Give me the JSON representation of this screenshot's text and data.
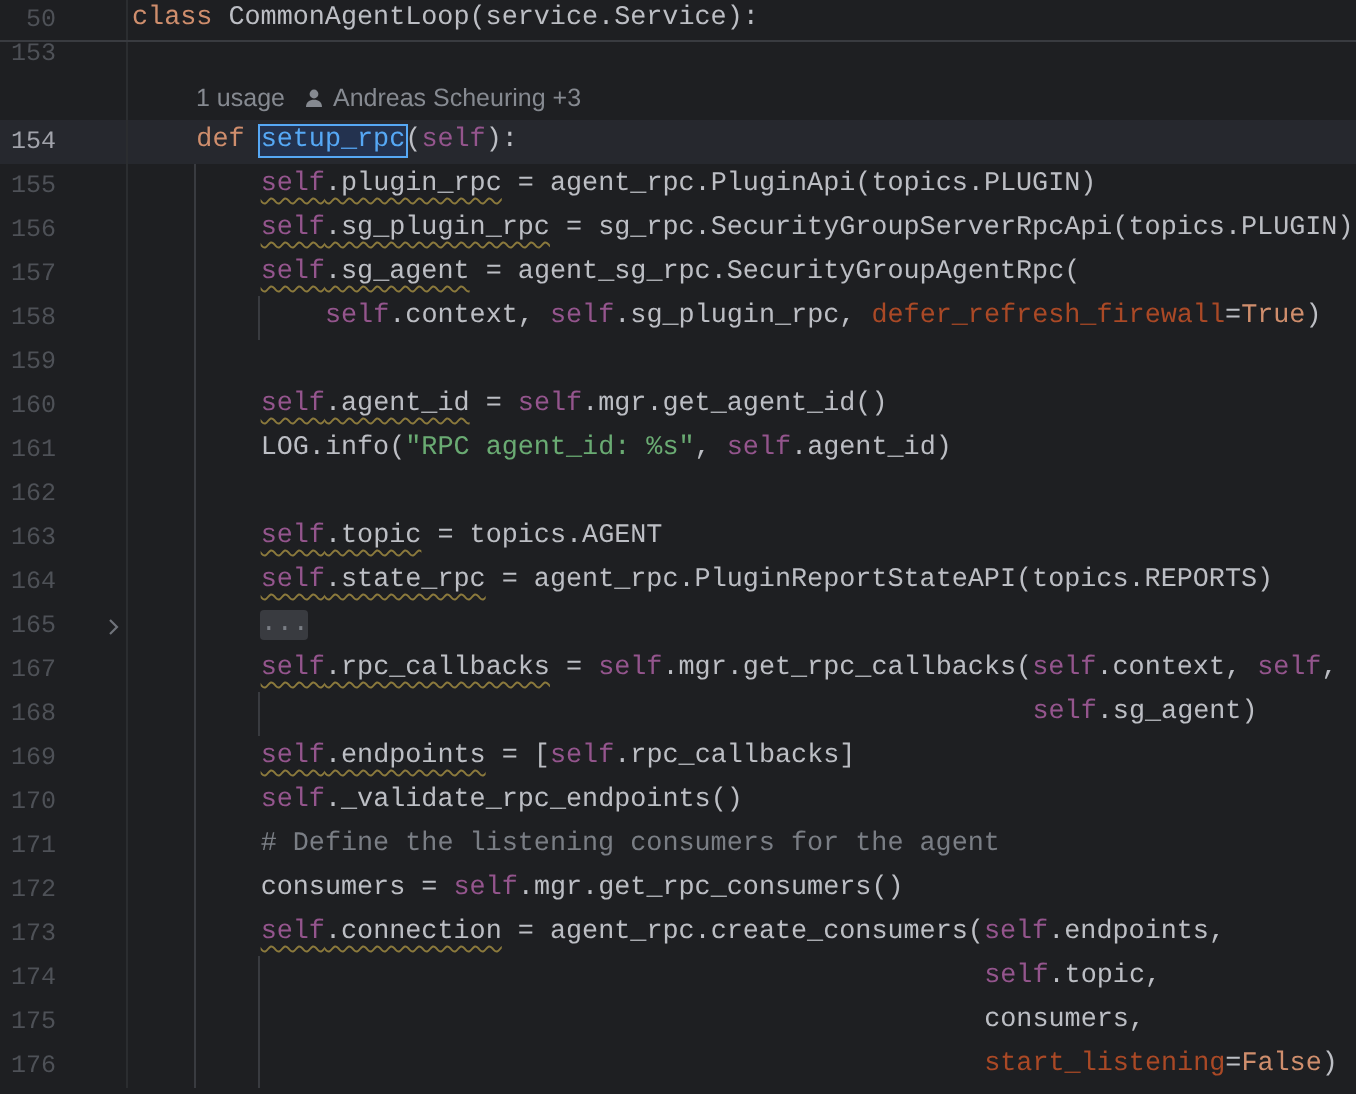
{
  "sticky_header": {
    "number": "50",
    "tokens": [
      {
        "kind": "keyword",
        "text": "class"
      },
      {
        "kind": "plain",
        "text": " CommonAgentLoop(service.Service):"
      }
    ]
  },
  "lines": [
    {
      "kind": "blank",
      "number": "153",
      "current": false,
      "foldable": false
    },
    {
      "kind": "inlay",
      "usage": "1 usage",
      "author": "Andreas Scheuring +3"
    },
    {
      "kind": "def",
      "number": "154",
      "current": true,
      "foldable": false,
      "tokens": [
        {
          "kind": "keyword",
          "text": "def "
        },
        {
          "kind": "function_selected",
          "text": "setup_rpc"
        },
        {
          "kind": "plain",
          "text": "("
        },
        {
          "kind": "self",
          "text": "self"
        },
        {
          "kind": "plain",
          "text": "):"
        }
      ]
    },
    {
      "kind": "body",
      "number": "155",
      "current": false,
      "foldable": false,
      "tokens": [
        {
          "kind": "self_warn",
          "text": "self"
        },
        {
          "kind": "plain_warn",
          "text": ".plugin_rpc"
        },
        {
          "kind": "plain",
          "text": " = agent_rpc.PluginApi(topics.PLUGIN)"
        }
      ]
    },
    {
      "kind": "body",
      "number": "156",
      "current": false,
      "foldable": false,
      "tokens": [
        {
          "kind": "self_warn",
          "text": "self"
        },
        {
          "kind": "plain_warn",
          "text": ".sg_plugin_rpc"
        },
        {
          "kind": "plain",
          "text": " = sg_rpc.SecurityGroupServerRpcApi(topics.PLUGIN)"
        }
      ]
    },
    {
      "kind": "body",
      "number": "157",
      "current": false,
      "foldable": false,
      "tokens": [
        {
          "kind": "self_warn",
          "text": "self"
        },
        {
          "kind": "plain_warn",
          "text": ".sg_agent"
        },
        {
          "kind": "plain",
          "text": " = agent_sg_rpc.SecurityGroupAgentRpc("
        }
      ]
    },
    {
      "kind": "hanging",
      "number": "158",
      "current": false,
      "foldable": false,
      "tokens": [
        {
          "kind": "self",
          "text": "self"
        },
        {
          "kind": "plain",
          "text": ".context, "
        },
        {
          "kind": "self",
          "text": "self"
        },
        {
          "kind": "plain",
          "text": ".sg_plugin_rpc, "
        },
        {
          "kind": "param",
          "text": "defer_refresh_firewall"
        },
        {
          "kind": "plain",
          "text": "="
        },
        {
          "kind": "keyword",
          "text": "True"
        },
        {
          "kind": "plain",
          "text": ")"
        }
      ]
    },
    {
      "kind": "blank",
      "number": "159",
      "current": false,
      "foldable": false
    },
    {
      "kind": "body",
      "number": "160",
      "current": false,
      "foldable": false,
      "tokens": [
        {
          "kind": "self_warn",
          "text": "self"
        },
        {
          "kind": "plain_warn",
          "text": ".agent_id"
        },
        {
          "kind": "plain",
          "text": " = "
        },
        {
          "kind": "self",
          "text": "self"
        },
        {
          "kind": "plain",
          "text": ".mgr.get_agent_id()"
        }
      ]
    },
    {
      "kind": "body",
      "number": "161",
      "current": false,
      "foldable": false,
      "tokens": [
        {
          "kind": "plain",
          "text": "LOG.info("
        },
        {
          "kind": "string",
          "text": "\"RPC agent_id: %s\""
        },
        {
          "kind": "plain",
          "text": ", "
        },
        {
          "kind": "self",
          "text": "self"
        },
        {
          "kind": "plain",
          "text": ".agent_id)"
        }
      ]
    },
    {
      "kind": "blank",
      "number": "162",
      "current": false,
      "foldable": false
    },
    {
      "kind": "body",
      "number": "163",
      "current": false,
      "foldable": false,
      "tokens": [
        {
          "kind": "self_warn",
          "text": "self"
        },
        {
          "kind": "plain_warn",
          "text": ".topic"
        },
        {
          "kind": "plain",
          "text": " = topics.AGENT"
        }
      ]
    },
    {
      "kind": "body",
      "number": "164",
      "current": false,
      "foldable": false,
      "tokens": [
        {
          "kind": "self_warn",
          "text": "self"
        },
        {
          "kind": "plain_warn",
          "text": ".state_rpc"
        },
        {
          "kind": "plain",
          "text": " = agent_rpc.PluginReportStateAPI(topics.REPORTS)"
        }
      ]
    },
    {
      "kind": "body",
      "number": "165",
      "current": false,
      "foldable": true,
      "tokens": [
        {
          "kind": "folded",
          "text": "..."
        }
      ]
    },
    {
      "kind": "body",
      "number": "167",
      "current": false,
      "foldable": false,
      "tokens": [
        {
          "kind": "self_warn",
          "text": "self"
        },
        {
          "kind": "plain_warn",
          "text": ".rpc_callbacks"
        },
        {
          "kind": "plain",
          "text": " = "
        },
        {
          "kind": "self",
          "text": "self"
        },
        {
          "kind": "plain",
          "text": ".mgr.get_rpc_callbacks("
        },
        {
          "kind": "self",
          "text": "self"
        },
        {
          "kind": "plain",
          "text": ".context, "
        },
        {
          "kind": "self",
          "text": "self"
        },
        {
          "kind": "plain",
          "text": ","
        }
      ]
    },
    {
      "kind": "aligned",
      "number": "168",
      "current": false,
      "foldable": false,
      "tokens": [
        {
          "kind": "self",
          "text": "self"
        },
        {
          "kind": "plain",
          "text": ".sg_agent)"
        }
      ]
    },
    {
      "kind": "body",
      "number": "169",
      "current": false,
      "foldable": false,
      "tokens": [
        {
          "kind": "self_warn",
          "text": "self"
        },
        {
          "kind": "plain_warn",
          "text": ".endpoints"
        },
        {
          "kind": "plain",
          "text": " = ["
        },
        {
          "kind": "self",
          "text": "self"
        },
        {
          "kind": "plain",
          "text": ".rpc_callbacks]"
        }
      ]
    },
    {
      "kind": "body",
      "number": "170",
      "current": false,
      "foldable": false,
      "tokens": [
        {
          "kind": "self",
          "text": "self"
        },
        {
          "kind": "plain",
          "text": "._validate_rpc_endpoints()"
        }
      ]
    },
    {
      "kind": "body",
      "number": "171",
      "current": false,
      "foldable": false,
      "tokens": [
        {
          "kind": "comment",
          "text": "# Define the listening consumers for the agent"
        }
      ]
    },
    {
      "kind": "body",
      "number": "172",
      "current": false,
      "foldable": false,
      "tokens": [
        {
          "kind": "plain",
          "text": "consumers = "
        },
        {
          "kind": "self",
          "text": "self"
        },
        {
          "kind": "plain",
          "text": ".mgr.get_rpc_consumers()"
        }
      ]
    },
    {
      "kind": "body",
      "number": "173",
      "current": false,
      "foldable": false,
      "tokens": [
        {
          "kind": "self_warn",
          "text": "self"
        },
        {
          "kind": "plain_warn",
          "text": ".connection"
        },
        {
          "kind": "plain",
          "text": " = agent_rpc.create_consumers("
        },
        {
          "kind": "self",
          "text": "self"
        },
        {
          "kind": "plain",
          "text": ".endpoints,"
        }
      ]
    },
    {
      "kind": "aligned",
      "number": "174",
      "current": false,
      "foldable": false,
      "tokens": [
        {
          "kind": "self",
          "text": "self"
        },
        {
          "kind": "plain",
          "text": ".topic,"
        }
      ]
    },
    {
      "kind": "aligned",
      "number": "175",
      "current": false,
      "foldable": false,
      "tokens": [
        {
          "kind": "plain",
          "text": "consumers,"
        }
      ]
    },
    {
      "kind": "aligned",
      "number": "176",
      "current": false,
      "foldable": false,
      "tokens": [
        {
          "kind": "param",
          "text": "start_listening"
        },
        {
          "kind": "plain",
          "text": "="
        },
        {
          "kind": "keyword",
          "text": "False"
        },
        {
          "kind": "plain",
          "text": ")"
        }
      ]
    }
  ]
}
